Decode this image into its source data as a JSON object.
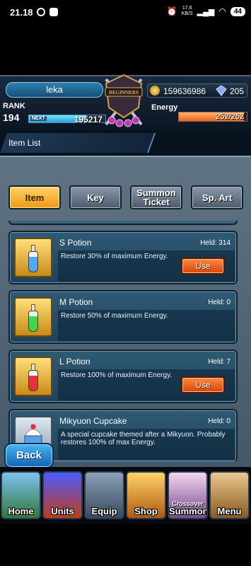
{
  "status_bar": {
    "time": "21.18",
    "net_speed_top": "17.6",
    "net_speed_bottom": "KB/S",
    "battery": "44"
  },
  "header": {
    "player_name": "leka",
    "rank_label": "RANK",
    "rank": "194",
    "next_label": "NEXT",
    "next_exp": "195217",
    "next_progress": 0.75,
    "emblem_text": "BEGINNERS",
    "gold": "159636986",
    "gems": "205",
    "energy_label": "Energy",
    "energy": "252/262",
    "energy_fraction": 0.96
  },
  "title": "Item List",
  "tabs": [
    {
      "label": "Item",
      "active": true
    },
    {
      "label": "Key",
      "active": false
    },
    {
      "label": "Summon Ticket",
      "active": false
    },
    {
      "label": "Sp. Art",
      "active": false
    }
  ],
  "items": [
    {
      "name": "S Potion",
      "held": "Held: 314",
      "desc": "Restore 30% of maximum Energy.",
      "button": "Use",
      "liquid": "#4fa8ff",
      "frame": "gold"
    },
    {
      "name": "M Potion",
      "held": "Held: 0",
      "desc": "Restore 50% of maximum Energy.",
      "button": "",
      "liquid": "#3fd84a",
      "frame": "gold"
    },
    {
      "name": "L Potion",
      "held": "Held: 7",
      "desc": "Restore 100% of maximum Energy.",
      "button": "Use",
      "liquid": "#e8303c",
      "frame": "gold"
    },
    {
      "name": "Mikyuon Cupcake",
      "held": "Held: 0",
      "desc": "A special cupcake themed after a Mikyuon. Probably restores 100% of max Energy.",
      "button": "",
      "liquid": "",
      "frame": "gray"
    }
  ],
  "back_button": "Back",
  "nav": [
    {
      "label": "Home",
      "sub": "",
      "icon": "house-icon"
    },
    {
      "label": "Units",
      "sub": "",
      "icon": "hero-icon"
    },
    {
      "label": "Equip",
      "sub": "",
      "icon": "swords-icon"
    },
    {
      "label": "Shop",
      "sub": "",
      "icon": "treasure-icon"
    },
    {
      "label": "Summon",
      "sub": "Crossover",
      "icon": "summon-icon"
    },
    {
      "label": "Menu",
      "sub": "",
      "icon": "book-icon"
    }
  ]
}
